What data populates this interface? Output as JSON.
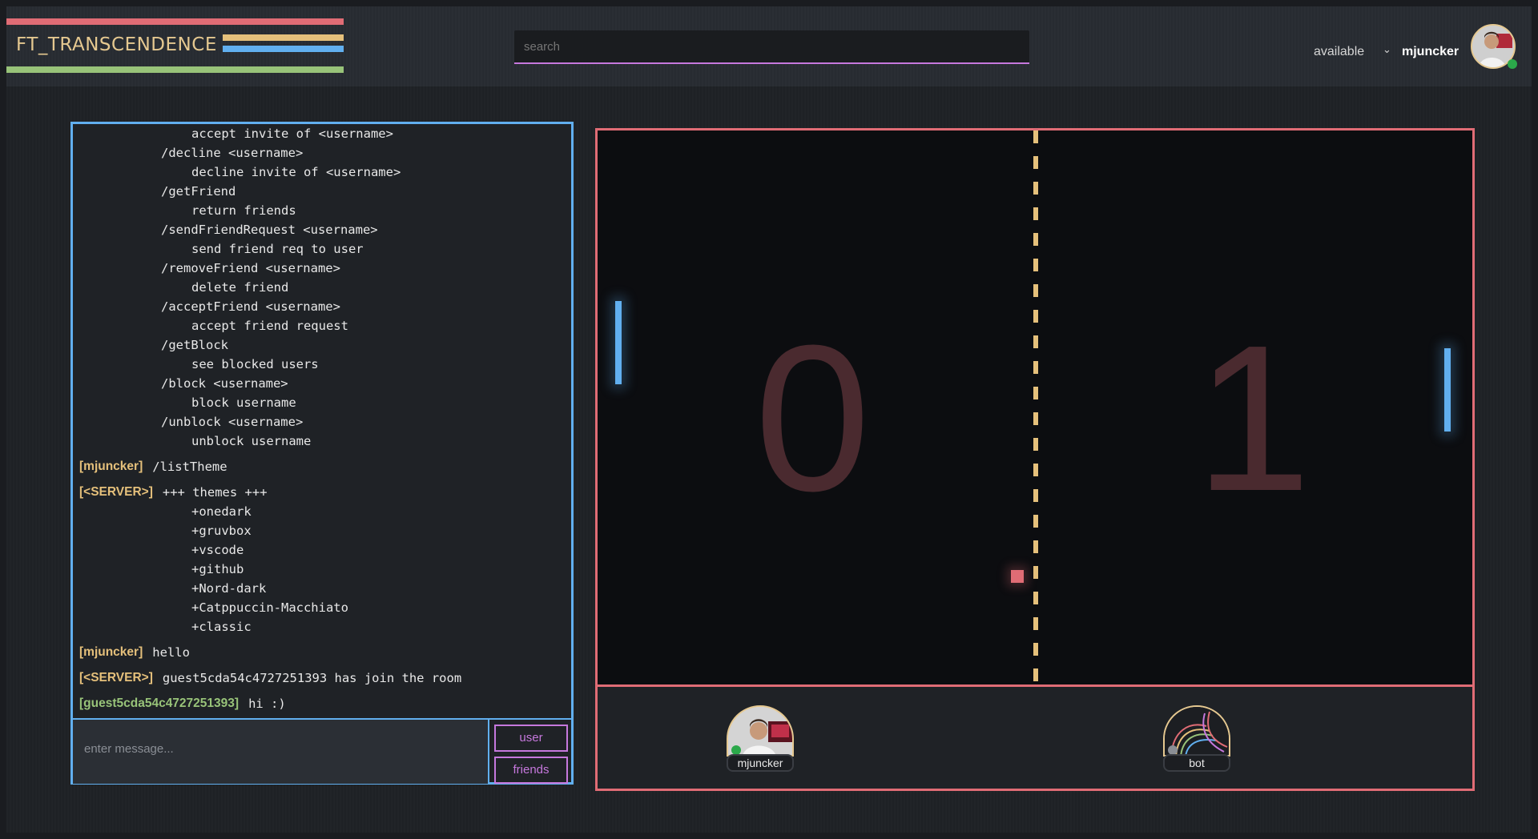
{
  "header": {
    "app_title": "FT_TRANSCENDENCE",
    "search_placeholder": "search",
    "status": "available",
    "username": "mjuncker",
    "colors": {
      "red": "#e06c75",
      "yellow": "#e5c07b",
      "blue": "#61afef",
      "green": "#98c379",
      "purple": "#c678dd"
    }
  },
  "chat": {
    "help_lines": [
      {
        "indent": 2,
        "text": "accept invite of <username>"
      },
      {
        "indent": 1,
        "text": "/decline <username>"
      },
      {
        "indent": 2,
        "text": "decline invite of <username>"
      },
      {
        "indent": 1,
        "text": "/getFriend"
      },
      {
        "indent": 2,
        "text": "return friends"
      },
      {
        "indent": 1,
        "text": "/sendFriendRequest <username>"
      },
      {
        "indent": 2,
        "text": "send friend req to user"
      },
      {
        "indent": 1,
        "text": "/removeFriend <username>"
      },
      {
        "indent": 2,
        "text": "delete friend"
      },
      {
        "indent": 1,
        "text": "/acceptFriend <username>"
      },
      {
        "indent": 2,
        "text": "accept friend request"
      },
      {
        "indent": 1,
        "text": "/getBlock"
      },
      {
        "indent": 2,
        "text": "see blocked users"
      },
      {
        "indent": 1,
        "text": "/block <username>"
      },
      {
        "indent": 2,
        "text": "block username"
      },
      {
        "indent": 1,
        "text": "/unblock <username>"
      },
      {
        "indent": 2,
        "text": "unblock username"
      }
    ],
    "messages": [
      {
        "sender": "[mjuncker]",
        "kind": "user",
        "text": "/listTheme",
        "extra": []
      },
      {
        "sender": "[<SERVER>]",
        "kind": "server",
        "text": "+++ themes +++",
        "extra": [
          "+onedark",
          "+gruvbox",
          "+vscode",
          "+github",
          "+Nord-dark",
          "+Catppuccin-Macchiato",
          "+classic"
        ]
      },
      {
        "sender": "[mjuncker]",
        "kind": "user",
        "text": "hello",
        "extra": []
      },
      {
        "sender": "[<SERVER>]",
        "kind": "server",
        "text": "guest5cda54c4727251393 has join the room",
        "extra": []
      },
      {
        "sender": "[guest5cda54c4727251393]",
        "kind": "guest",
        "text": "hi :)",
        "extra": []
      }
    ],
    "input_placeholder": "enter message...",
    "user_button": "user",
    "friends_button": "friends"
  },
  "game": {
    "score_left": "0",
    "score_right": "1",
    "player_left": "mjuncker",
    "player_right": "bot"
  }
}
